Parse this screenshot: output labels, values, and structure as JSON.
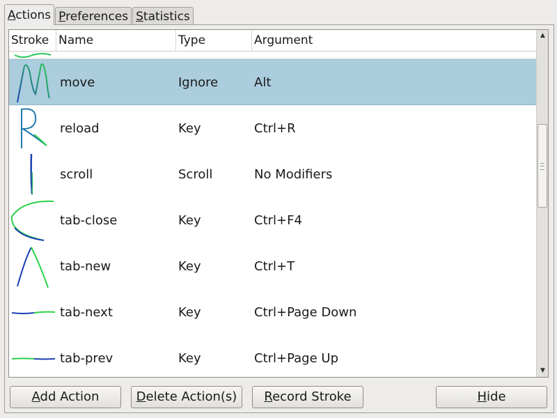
{
  "tabs": [
    {
      "label": "Actions",
      "mnemonic_index": 0,
      "active": true
    },
    {
      "label": "Preferences",
      "mnemonic_index": 0,
      "active": false
    },
    {
      "label": "Statistics",
      "mnemonic_index": 0,
      "active": false
    }
  ],
  "table": {
    "columns": [
      "Stroke",
      "Name",
      "Type",
      "Argument"
    ],
    "rows": [
      {
        "stroke_icon": "gesture-m-stroke-icon",
        "name": "move",
        "type": "Ignore",
        "argument": "Alt",
        "selected": true
      },
      {
        "stroke_icon": "gesture-r-stroke-icon",
        "name": "reload",
        "type": "Key",
        "argument": "Ctrl+R",
        "selected": false
      },
      {
        "stroke_icon": "gesture-vertical-stroke-icon",
        "name": "scroll",
        "type": "Scroll",
        "argument": "No Modifiers",
        "selected": false
      },
      {
        "stroke_icon": "gesture-c-stroke-icon",
        "name": "tab-close",
        "type": "Key",
        "argument": "Ctrl+F4",
        "selected": false
      },
      {
        "stroke_icon": "gesture-caret-stroke-icon",
        "name": "tab-new",
        "type": "Key",
        "argument": "Ctrl+T",
        "selected": false
      },
      {
        "stroke_icon": "gesture-right-stroke-icon",
        "name": "tab-next",
        "type": "Key",
        "argument": "Ctrl+Page Down",
        "selected": false
      },
      {
        "stroke_icon": "gesture-left-stroke-icon",
        "name": "tab-prev",
        "type": "Key",
        "argument": "Ctrl+Page Up",
        "selected": false
      }
    ]
  },
  "buttons": {
    "add": "Add Action",
    "delete": "Delete Action(s)",
    "record": "Record Stroke",
    "hide": "Hide"
  },
  "colors": {
    "selection": "#abcddd",
    "stroke_start": "#1a3fb5",
    "stroke_end": "#2bd24a"
  }
}
